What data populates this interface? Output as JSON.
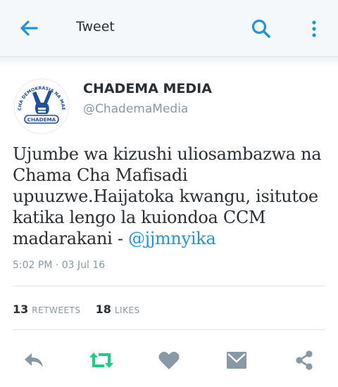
{
  "header": {
    "title": "Tweet",
    "back_icon": "arrow-left-icon",
    "search_icon": "search-icon",
    "more_icon": "more-vertical-icon",
    "accent": "#1b95e0"
  },
  "tweet": {
    "author_name": "CHADEMA MEDIA",
    "author_handle": "@ChademaMedia",
    "avatar": {
      "arc_text": "CHAMA CHA DEMOKRASIA NA MAENDELEO",
      "badge": "CHADEMA"
    },
    "text": "Ujumbe wa kizushi uliosambazwa na Chama Cha Mafisadi upuuzwe.Haijatoka kwangu, isitutoe katika lengo la kuiondoa CCM madarakani - ",
    "mention": "@jjmnyika",
    "timestamp": "5:02 PM · 03 Jul 16",
    "retweets_count": "13",
    "retweets_label": "RETWEETS",
    "likes_count": "18",
    "likes_label": "LIKES"
  },
  "actions": {
    "reply_icon": "reply-icon",
    "retweet_icon": "retweet-icon",
    "retweet_color": "#19cf86",
    "like_icon": "heart-icon",
    "dm_icon": "envelope-icon",
    "share_icon": "share-icon",
    "icon_color": "#8899a6"
  }
}
